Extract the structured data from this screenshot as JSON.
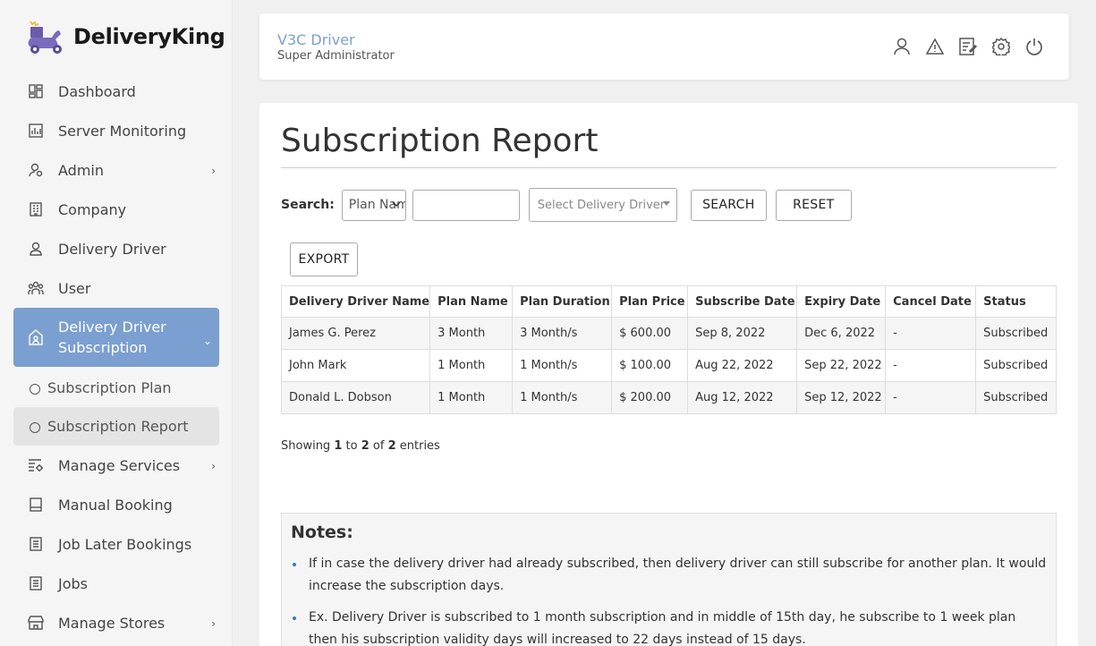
{
  "brand": {
    "name": "DeliveryKing"
  },
  "sidebar": {
    "items": [
      {
        "label": "Dashboard",
        "icon": "dashboard-icon"
      },
      {
        "label": "Server Monitoring",
        "icon": "chart-icon"
      },
      {
        "label": "Admin",
        "icon": "admin-icon",
        "arrow": "›"
      },
      {
        "label": "Company",
        "icon": "company-icon"
      },
      {
        "label": "Delivery Driver",
        "icon": "driver-icon"
      },
      {
        "label": "User",
        "icon": "users-icon"
      },
      {
        "label": "Delivery Driver Subscription",
        "icon": "subscription-icon",
        "arrow": "⌄"
      },
      {
        "label": "Subscription Plan"
      },
      {
        "label": "Subscription Report"
      },
      {
        "label": "Manage Services",
        "icon": "services-icon",
        "arrow": "›"
      },
      {
        "label": "Manual Booking",
        "icon": "booking-icon"
      },
      {
        "label": "Job Later Bookings",
        "icon": "list-icon"
      },
      {
        "label": "Jobs",
        "icon": "jobs-icon"
      },
      {
        "label": "Manage Stores",
        "icon": "store-icon",
        "arrow": "›"
      }
    ]
  },
  "header": {
    "user_name": "V3C Driver",
    "user_role": "Super Administrator"
  },
  "page": {
    "title": "Subscription Report"
  },
  "search": {
    "label": "Search:",
    "plan_select": "Plan Name",
    "text_value": "",
    "driver_placeholder": "Select Delivery Driver",
    "search_btn": "SEARCH",
    "reset_btn": "RESET",
    "export_btn": "EXPORT"
  },
  "table": {
    "headers": [
      "Delivery Driver Name",
      "Plan Name",
      "Plan Duration",
      "Plan Price",
      "Subscribe Date",
      "Expiry Date",
      "Cancel Date",
      "Status"
    ],
    "rows": [
      [
        "James G. Perez",
        "3 Month",
        "3 Month/s",
        "$ 600.00",
        "Sep 8, 2022",
        "Dec 6, 2022",
        "-",
        "Subscribed"
      ],
      [
        "John Mark",
        "1 Month",
        "1 Month/s",
        "$ 100.00",
        "Aug 22, 2022",
        "Sep 22, 2022",
        "-",
        "Subscribed"
      ],
      [
        "Donald L. Dobson",
        "1 Month",
        "1 Month/s",
        "$ 200.00",
        "Aug 12, 2022",
        "Sep 12, 2022",
        "-",
        "Subscribed"
      ]
    ]
  },
  "showing": {
    "prefix": "Showing",
    "from": "1",
    "to_word": "to",
    "to": "2",
    "of_word": "of",
    "total": "2",
    "suffix": "entries"
  },
  "notes": {
    "title": "Notes:",
    "items": [
      "If in case the delivery driver had already subscribed, then delivery driver can still subscribe for another plan. It would increase the subscription days.",
      "Ex. Delivery Driver is subscribed to 1 month subscription and in middle of 15th day, he subscribe to 1 week plan then his subscription validity days will increased to 22 days instead of 15 days."
    ]
  },
  "colors": {
    "accent": "#7b9fd0",
    "sidebar_bg": "#f5f5f5",
    "page_bg": "#f0f0f0"
  }
}
